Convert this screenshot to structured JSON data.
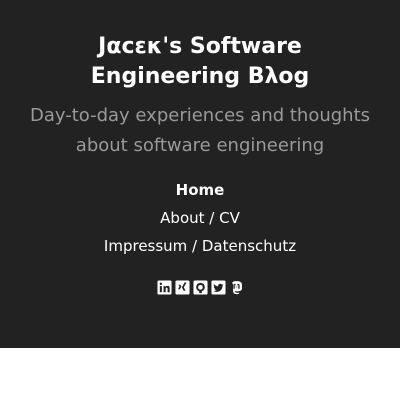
{
  "site": {
    "title": "Jαcεκ's Software Engineering Bλog",
    "tagline": "Day-to-day experiences and thoughts about software engineering"
  },
  "nav": {
    "items": [
      {
        "label": "Home",
        "active": true
      },
      {
        "label": "About / CV",
        "active": false
      },
      {
        "label": "Impressum / Datenschutz",
        "active": false
      }
    ]
  },
  "social": {
    "icons": [
      "linkedin-icon",
      "xing-icon",
      "github-icon",
      "twitter-icon",
      "mastodon-icon"
    ]
  },
  "colors": {
    "header_bg": "#222222",
    "title": "#ffffff",
    "tagline": "#9a9a9a",
    "page_bg": "#ffffff"
  }
}
